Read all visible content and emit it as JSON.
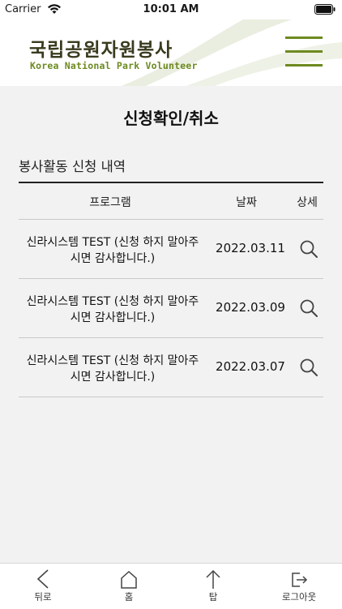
{
  "status_bar": {
    "carrier": "Carrier",
    "time": "10:01 AM",
    "icons": [
      "wifi-icon",
      "battery-icon"
    ]
  },
  "header": {
    "logo_kr": "국립공원자원봉사",
    "logo_en": "Korea National Park Volunteer",
    "menu_icon": "hamburger-menu-icon",
    "accent_color": "#6d8a1f"
  },
  "main": {
    "page_title": "신청확인/취소",
    "section_title": "봉사활동 신청 내역",
    "table": {
      "headers": {
        "program": "프로그램",
        "date": "날짜",
        "detail": "상세"
      },
      "rows": [
        {
          "program_line1": "신라시스템 TEST (신청 하지 말아주",
          "program_line2": "시면 감사합니다.)",
          "date": "2022.03.11",
          "detail_icon": "search-icon"
        },
        {
          "program_line1": "신라시스템 TEST (신청 하지 말아주",
          "program_line2": "시면 감사합니다.)",
          "date": "2022.03.09",
          "detail_icon": "search-icon"
        },
        {
          "program_line1": "신라시스템 TEST (신청 하지 말아주",
          "program_line2": "시면 감사합니다.)",
          "date": "2022.03.07",
          "detail_icon": "search-icon"
        }
      ]
    }
  },
  "bottom_nav": {
    "back": {
      "label": "뒤로",
      "icon": "chevron-left-icon"
    },
    "home": {
      "label": "홈",
      "icon": "home-icon"
    },
    "top": {
      "label": "탑",
      "icon": "arrow-up-icon"
    },
    "logout": {
      "label": "로그아웃",
      "icon": "logout-icon"
    }
  }
}
